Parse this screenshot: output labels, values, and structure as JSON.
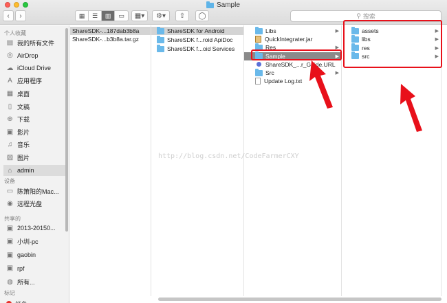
{
  "window": {
    "title": "Sample"
  },
  "toolbar": {
    "back": "‹",
    "forward": "›",
    "search_placeholder": "搜索"
  },
  "sidebar": {
    "section_personal": "个人收藏",
    "personal": [
      {
        "label": "我的所有文件",
        "icon": "all-files-icon"
      },
      {
        "label": "AirDrop",
        "icon": "airdrop-icon"
      },
      {
        "label": "iCloud Drive",
        "icon": "cloud-icon"
      },
      {
        "label": "应用程序",
        "icon": "applications-icon"
      },
      {
        "label": "桌面",
        "icon": "desktop-icon"
      },
      {
        "label": "文稿",
        "icon": "documents-icon"
      },
      {
        "label": "下载",
        "icon": "downloads-icon"
      },
      {
        "label": "影片",
        "icon": "movies-icon"
      },
      {
        "label": "音乐",
        "icon": "music-icon"
      },
      {
        "label": "图片",
        "icon": "pictures-icon"
      },
      {
        "label": "admin",
        "icon": "home-icon"
      }
    ],
    "section_devices": "设备",
    "devices": [
      {
        "label": "陈箫阳的Mac...",
        "icon": "computer-icon"
      },
      {
        "label": "远程光盘",
        "icon": "disc-icon"
      }
    ],
    "section_shared": "共享的",
    "shared": [
      {
        "label": "2013-20150...",
        "icon": "monitor-icon"
      },
      {
        "label": "小圳-pc",
        "icon": "monitor-icon"
      },
      {
        "label": "gaobin",
        "icon": "monitor-icon"
      },
      {
        "label": "rpf",
        "icon": "monitor-icon"
      },
      {
        "label": "所有...",
        "icon": "network-icon"
      }
    ],
    "section_tags": "标记",
    "tags": [
      {
        "label": "红色",
        "color": "#e8302a"
      }
    ]
  },
  "columns": {
    "col1": [
      {
        "name": "ShareSDK-...187dab3b8a",
        "type": "folder-plain"
      },
      {
        "name": "ShareSDK-...b3b8a.tar.gz",
        "type": "file-plain"
      }
    ],
    "col2": [
      {
        "name": "ShareSDK for Android",
        "type": "folder"
      },
      {
        "name": "ShareSDK f...roid ApiDoc",
        "type": "folder"
      },
      {
        "name": "ShareSDK f...oid Services",
        "type": "folder"
      }
    ],
    "col3": [
      {
        "name": "Libs",
        "type": "folder"
      },
      {
        "name": "QuickIntegrater.jar",
        "type": "jar"
      },
      {
        "name": "Res",
        "type": "folder"
      },
      {
        "name": "Sample",
        "type": "folder"
      },
      {
        "name": "ShareSDK_...r_Guide.URL",
        "type": "url"
      },
      {
        "name": "Src",
        "type": "folder"
      },
      {
        "name": "Update Log.txt",
        "type": "doc"
      }
    ],
    "col4": [
      {
        "name": "assets",
        "type": "folder"
      },
      {
        "name": "libs",
        "type": "folder"
      },
      {
        "name": "res",
        "type": "folder"
      },
      {
        "name": "src",
        "type": "folder"
      }
    ]
  },
  "watermark": "http://blog.csdn.net/CodeFarmerCXY",
  "colors": {
    "annotation": "#e8101a",
    "folder": "#6ab9ea",
    "selection": "#8a8a8a"
  }
}
